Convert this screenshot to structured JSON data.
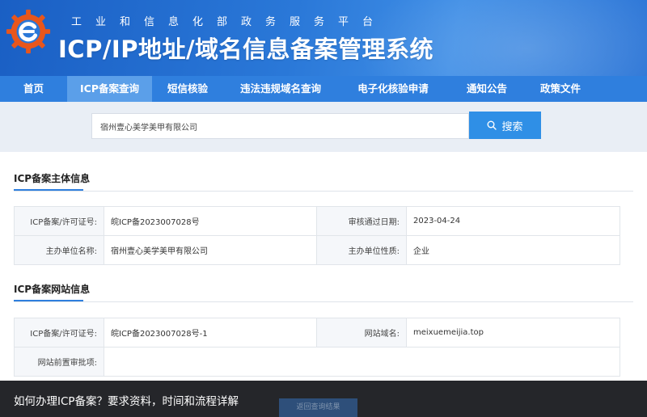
{
  "header": {
    "org_name": "工业和信息化部政务服务平台",
    "system_title": "ICP/IP地址/域名信息备案管理系统"
  },
  "nav": {
    "items": [
      {
        "label": "首页"
      },
      {
        "label": "ICP备案查询",
        "active": true
      },
      {
        "label": "短信核验"
      },
      {
        "label": "违法违规域名查询"
      },
      {
        "label": "电子化核验申请"
      },
      {
        "label": "通知公告"
      },
      {
        "label": "政策文件"
      }
    ]
  },
  "search": {
    "value": "宿州壹心美学美甲有限公司",
    "button_label": "搜索",
    "button_icon": "search-icon"
  },
  "subject_section": {
    "title": "ICP备案主体信息",
    "rows": [
      {
        "label1": "ICP备案/许可证号:",
        "value1": "皖ICP备2023007028号",
        "label2": "审核通过日期:",
        "value2": "2023-04-24"
      },
      {
        "label1": "主办单位名称:",
        "value1": "宿州壹心美学美甲有限公司",
        "label2": "主办单位性质:",
        "value2": "企业"
      }
    ]
  },
  "website_section": {
    "title": "ICP备案网站信息",
    "license_label": "ICP备案/许可证号:",
    "license_value": "皖ICP备2023007028号-1",
    "domain_label": "网站域名:",
    "domain_value": "meixuemeijia.top",
    "preapproval_label": "网站前置审批项:",
    "preapproval_value": ""
  },
  "caption": {
    "text": "如何办理ICP备案？要求资料，时间和流程详解"
  },
  "footer_button": {
    "label": "返回查询结果"
  },
  "colors": {
    "header_blue": "#1a5fc4",
    "nav_blue": "#2f7fde",
    "nav_active": "#5b9fe9",
    "search_button": "#2f8fe6",
    "logo_orange": "#e8561c"
  }
}
